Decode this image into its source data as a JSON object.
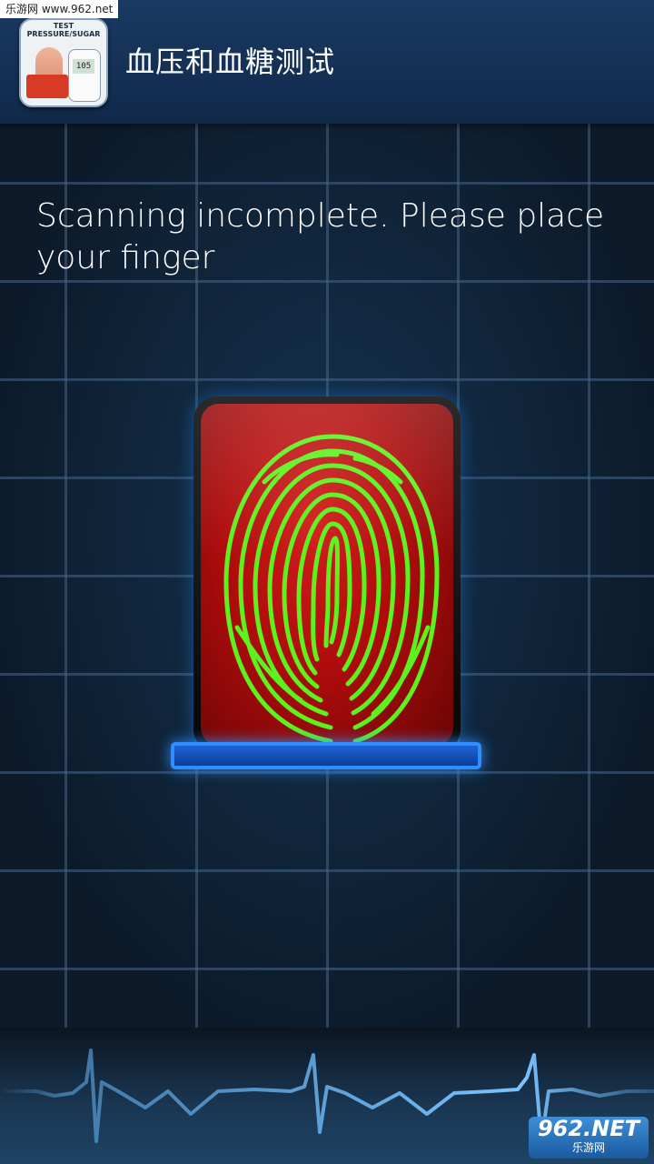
{
  "watermark_top": "乐游网 www.962.net",
  "app": {
    "title": "血压和血糖测试",
    "icon_label_line1": "TEST",
    "icon_label_line2": "PRESSURE/SUGAR",
    "icon_meter_value": "105"
  },
  "main": {
    "instruction": "Scanning incomplete. Please place your finger"
  },
  "colors": {
    "appbar": "#14335a",
    "pad_red": "#c41414",
    "fingerprint_green": "#5cf21e",
    "scan_glow": "#2f8dff",
    "ecg_line": "#5aa8e6"
  },
  "icons": {
    "app_icon": "blood-pressure-sugar-app-icon",
    "fingerprint": "fingerprint-icon",
    "ecg": "heartbeat-line-icon"
  },
  "watermark_bottom": {
    "main": "962.NET",
    "sub": "乐游网"
  }
}
